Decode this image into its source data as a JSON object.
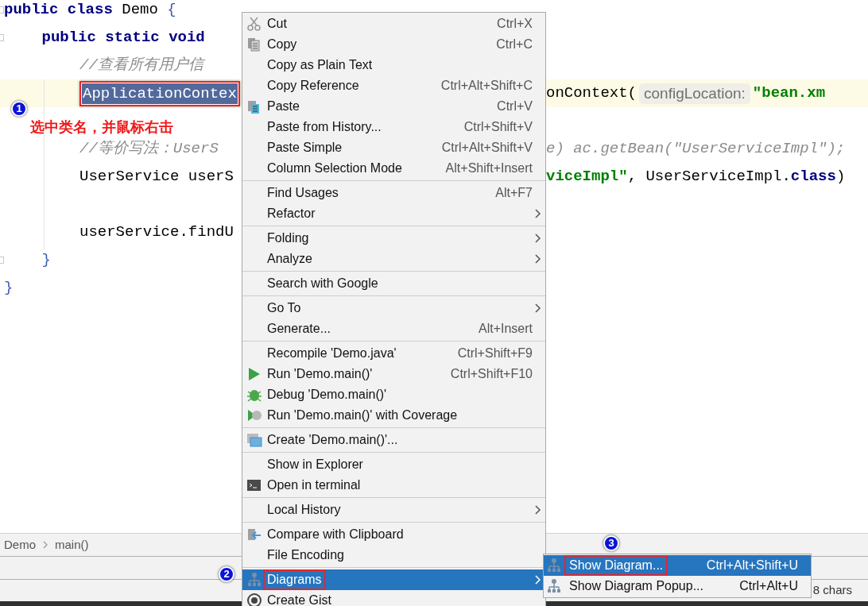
{
  "editor": {
    "lines": [
      {
        "tokens": [
          {
            "kind": "keyword",
            "text": "public class"
          },
          {
            "kind": "plain",
            "text": " Demo "
          },
          {
            "kind": "brace",
            "text": "{"
          }
        ],
        "fold": true,
        "children": [
          {
            "tokens": [
              {
                "kind": "keyword",
                "text": "public static void"
              }
            ],
            "fold": true,
            "children": [
              {
                "tokens": [
                  {
                    "kind": "comment",
                    "text": "//查看所有用户信"
                  }
                ]
              },
              {
                "tokens": [
                  {
                    "kind": "selected",
                    "text": "ApplicationContex"
                  }
                ],
                "right": [
                  {
                    "kind": "plain",
                    "text": "onContext("
                  },
                  {
                    "kind": "hint",
                    "text": "configLocation:"
                  },
                  {
                    "kind": "string",
                    "text": "\"bean.xm"
                  }
                ],
                "current": true
              },
              {
                "kind": "blank"
              },
              {
                "tokens": [
                  {
                    "kind": "comment",
                    "text": "//等价写法：UserS"
                  }
                ],
                "right": [
                  {
                    "kind": "comment",
                    "text": "e) ac.getBean(\"UserServiceImpl\");"
                  }
                ]
              },
              {
                "tokens": [
                  {
                    "kind": "plain",
                    "text": "UserService userS"
                  }
                ],
                "right": [
                  {
                    "kind": "string",
                    "text": "viceImpl\""
                  },
                  {
                    "kind": "plain",
                    "text": ", UserServiceImpl."
                  },
                  {
                    "kind": "keyword",
                    "text": "class"
                  },
                  {
                    "kind": "plain",
                    "text": ")"
                  }
                ]
              },
              {
                "kind": "blank"
              },
              {
                "tokens": [
                  {
                    "kind": "plain",
                    "text": "userService.findU"
                  }
                ]
              }
            ]
          },
          {
            "tokens": [
              {
                "kind": "brace",
                "text": "}"
              }
            ],
            "fold": true
          }
        ]
      },
      {
        "tokens": [
          {
            "kind": "brace",
            "text": "}"
          }
        ]
      }
    ]
  },
  "annotations": [
    {
      "number": "1",
      "note": "选中类名，并鼠标右击"
    },
    {
      "number": "2"
    },
    {
      "number": "3"
    }
  ],
  "breadcrumb": [
    "Demo",
    "main()"
  ],
  "status_bar": {
    "selection": "8 chars"
  },
  "context_menu": {
    "groups": [
      [
        {
          "label": "Cut",
          "shortcut": "Ctrl+X",
          "submenu": false,
          "selected": false
        },
        {
          "label": "Copy",
          "shortcut": "Ctrl+C",
          "submenu": false,
          "selected": false
        },
        {
          "label": "Copy as Plain Text",
          "submenu": false,
          "selected": false
        },
        {
          "label": "Copy Reference",
          "shortcut": "Ctrl+Alt+Shift+C",
          "submenu": false,
          "selected": false
        },
        {
          "label": "Paste",
          "shortcut": "Ctrl+V",
          "submenu": false,
          "selected": false
        },
        {
          "label": "Paste from History...",
          "shortcut": "Ctrl+Shift+V",
          "submenu": false,
          "selected": false
        },
        {
          "label": "Paste Simple",
          "shortcut": "Ctrl+Alt+Shift+V",
          "submenu": false,
          "selected": false
        },
        {
          "label": "Column Selection Mode",
          "shortcut": "Alt+Shift+Insert",
          "submenu": false,
          "selected": false
        }
      ],
      [
        {
          "label": "Find Usages",
          "shortcut": "Alt+F7",
          "submenu": false,
          "selected": false
        },
        {
          "label": "Refactor",
          "submenu": true,
          "selected": false
        }
      ],
      [
        {
          "label": "Folding",
          "submenu": true,
          "selected": false
        },
        {
          "label": "Analyze",
          "submenu": true,
          "selected": false
        }
      ],
      [
        {
          "label": "Search with Google",
          "submenu": false,
          "selected": false
        }
      ],
      [
        {
          "label": "Go To",
          "submenu": true,
          "selected": false
        },
        {
          "label": "Generate...",
          "shortcut": "Alt+Insert",
          "submenu": false,
          "selected": false
        }
      ],
      [
        {
          "label": "Recompile 'Demo.java'",
          "shortcut": "Ctrl+Shift+F9",
          "submenu": false,
          "selected": false
        },
        {
          "label": "Run 'Demo.main()'",
          "shortcut": "Ctrl+Shift+F10",
          "submenu": false,
          "selected": false
        },
        {
          "label": "Debug 'Demo.main()'",
          "submenu": false,
          "selected": false
        },
        {
          "label": "Run 'Demo.main()' with Coverage",
          "submenu": false,
          "selected": false
        }
      ],
      [
        {
          "label": "Create 'Demo.main()'...",
          "submenu": false,
          "selected": false
        }
      ],
      [
        {
          "label": "Show in Explorer",
          "submenu": false,
          "selected": false
        },
        {
          "label": "Open in terminal",
          "submenu": false,
          "selected": false
        }
      ],
      [
        {
          "label": "Local History",
          "submenu": true,
          "selected": false
        }
      ],
      [
        {
          "label": "Compare with Clipboard",
          "submenu": false,
          "selected": false
        },
        {
          "label": "File Encoding",
          "submenu": false,
          "selected": false
        }
      ],
      [
        {
          "label": "Diagrams",
          "submenu": true,
          "selected": true,
          "framed": true
        },
        {
          "label": "Create Gist",
          "submenu": false,
          "selected": false
        }
      ]
    ]
  },
  "submenu": {
    "items": [
      {
        "label": "Show Diagram...",
        "shortcut": "Ctrl+Alt+Shift+U",
        "selected": true,
        "framed": true
      },
      {
        "label": "Show Diagram Popup...",
        "shortcut": "Ctrl+Alt+U",
        "selected": false,
        "framed": false
      }
    ]
  }
}
